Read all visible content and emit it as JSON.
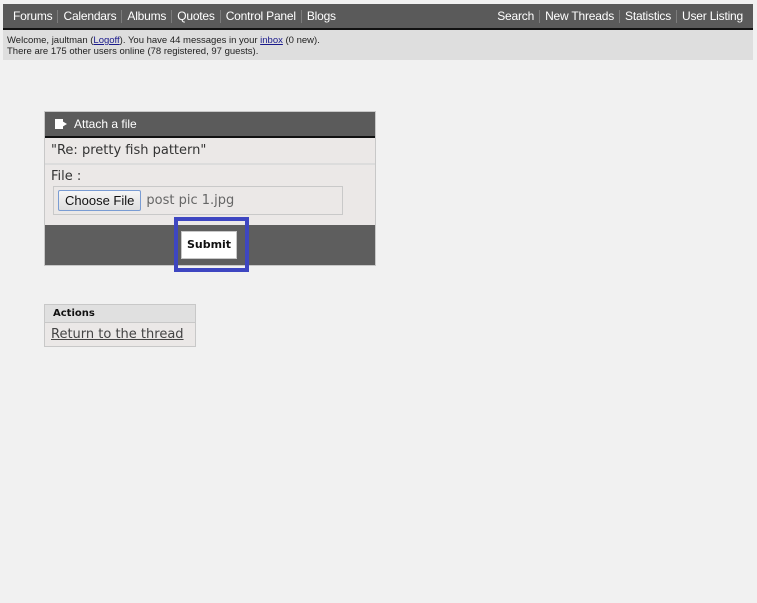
{
  "nav": {
    "left": [
      "Forums",
      "Calendars",
      "Albums",
      "Quotes",
      "Control Panel",
      "Blogs"
    ],
    "right": [
      "Search",
      "New Threads",
      "Statistics",
      "User Listing"
    ]
  },
  "welcome": {
    "prefix": "Welcome, jaultman (",
    "logoff": "Logoff",
    "mid": "). You have 44 messages in your ",
    "inbox": "inbox",
    "suffix": " (0 new).",
    "online": "There are 175 other users online (78 registered, 97 guests)."
  },
  "attach": {
    "header": "Attach a file",
    "header_icon": "attach-file-icon",
    "thread_title": "\"Re: pretty fish pattern\"",
    "file_label": "File :",
    "choose_button": "Choose File",
    "file_name": "post pic 1.jpg",
    "submit_button": "Submit",
    "highlight_color": "#3e46c1"
  },
  "actions": {
    "header": "Actions",
    "return_link": "Return to the thread"
  }
}
